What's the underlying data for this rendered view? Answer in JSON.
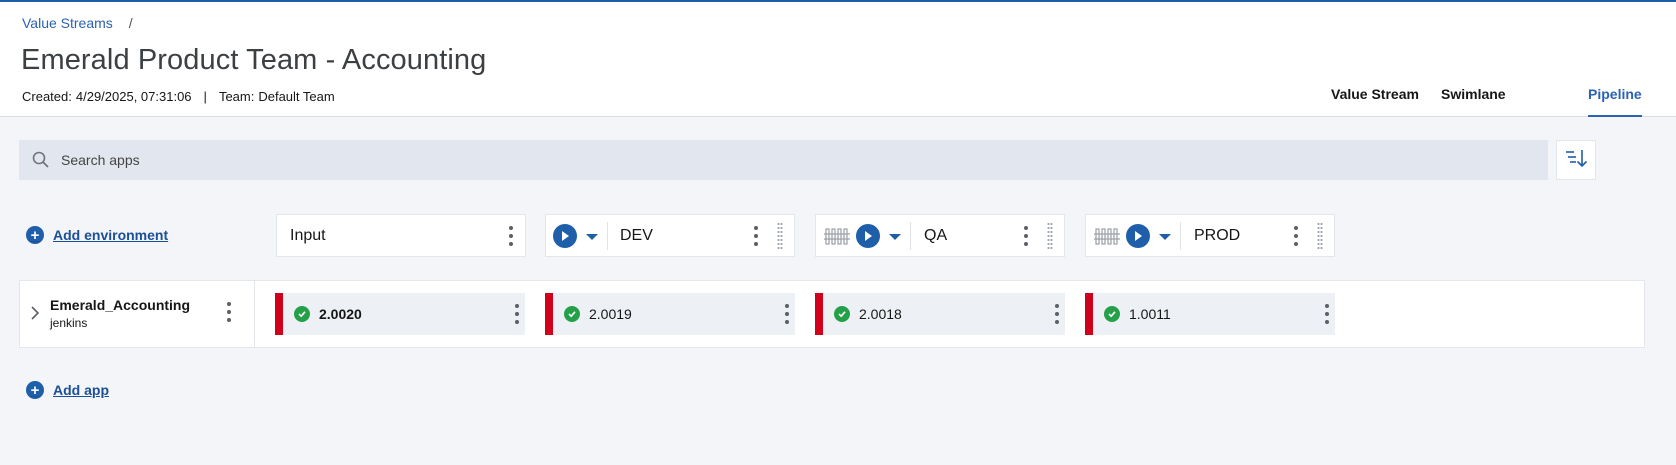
{
  "breadcrumb": {
    "root": "Value Streams",
    "separator": "/"
  },
  "page": {
    "title": "Emerald Product Team - Accounting",
    "created_label": "Created:",
    "created_value": "4/29/2025, 07:31:06",
    "team_label": "Team:",
    "team_value": "Default Team",
    "meta_separator": "|"
  },
  "tabs": [
    {
      "label": "Value Stream",
      "active": false
    },
    {
      "label": "Swimlane",
      "active": false
    },
    {
      "label": "Pipeline",
      "active": true
    }
  ],
  "search": {
    "placeholder": "Search apps",
    "value": ""
  },
  "actions": {
    "add_environment": "Add environment",
    "add_app": "Add app"
  },
  "environments": [
    {
      "name": "Input"
    },
    {
      "name": "DEV"
    },
    {
      "name": "QA"
    },
    {
      "name": "PROD"
    }
  ],
  "apps": [
    {
      "name": "Emerald_Accounting",
      "source": "jenkins",
      "versions": [
        "2.0020",
        "2.0019",
        "2.0018",
        "1.0011"
      ],
      "status": "success"
    }
  ],
  "colors": {
    "accent": "#1f5ea8",
    "link": "#2b62b3",
    "status_bar": "#d0021b",
    "success": "#24a148",
    "background": "#f4f5f8"
  },
  "icons": {
    "search": "search-icon",
    "sort": "sort-descending-icon",
    "add": "plus-circle-icon",
    "overflow": "overflow-menu-vertical-icon",
    "drag": "drag-handle-icon",
    "deploy": "play-circle-icon",
    "dropdown": "caret-down-icon",
    "gate": "gate-fence-icon",
    "expand": "chevron-right-icon",
    "status": "checkmark-filled-icon"
  }
}
